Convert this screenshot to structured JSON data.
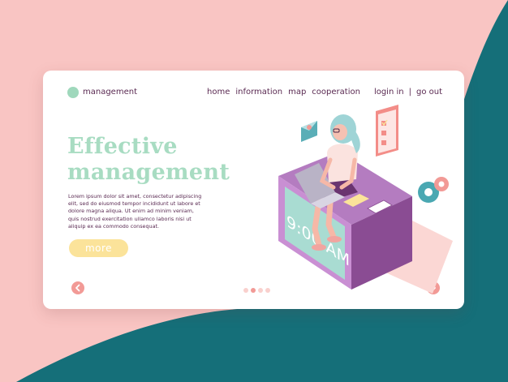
{
  "brand": {
    "name": "management"
  },
  "nav": {
    "items": [
      "home",
      "information",
      "map",
      "cooperation"
    ]
  },
  "auth": {
    "login": "login in",
    "separator": "|",
    "logout": "go out"
  },
  "hero": {
    "title_line1": "Effective",
    "title_line2": "management",
    "body": "Lorem ipsum dolor sit amet, consectetur adipiscing elit, sed do eiusmod tempor incididunt ut labore et dolore magna aliqua. Ut enim ad minim veniam, quis nostrud exercitation ullamco laboris nisi ut aliquip ex ea commodo consequat.",
    "more_label": "more"
  },
  "clock": {
    "text": "9:00 AM"
  },
  "pagination": {
    "pages": 3,
    "active_index": 1
  },
  "colors": {
    "background_pink": "#f9c5c3",
    "background_teal": "#156f79",
    "accent_mint": "#a8dcc2",
    "text_plum": "#5a2a52",
    "button_yellow": "#fbe39a",
    "arrow_coral": "#f29a96"
  },
  "icons": {
    "prev": "chevron-left-icon",
    "next": "chevron-right-icon",
    "email": "email-envelope-icon",
    "checklist": "checklist-icon",
    "gears": "gears-icon"
  }
}
